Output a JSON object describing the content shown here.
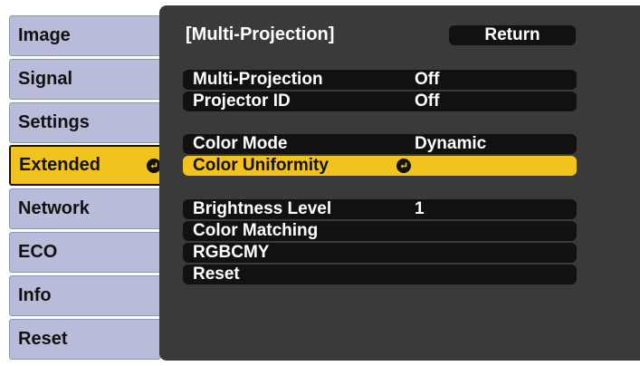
{
  "tabs": [
    {
      "label": "Image",
      "active": false
    },
    {
      "label": "Signal",
      "active": false
    },
    {
      "label": "Settings",
      "active": false
    },
    {
      "label": "Extended",
      "active": true
    },
    {
      "label": "Network",
      "active": false
    },
    {
      "label": "ECO",
      "active": false
    },
    {
      "label": "Info",
      "active": false
    },
    {
      "label": "Reset",
      "active": false
    }
  ],
  "header": {
    "title": "[Multi-Projection]",
    "return_label": "Return"
  },
  "groups": [
    [
      {
        "label": "Multi-Projection",
        "value": "Off"
      },
      {
        "label": "Projector ID",
        "value": "Off"
      }
    ],
    [
      {
        "label": "Color Mode",
        "value": "Dynamic"
      },
      {
        "label": "Color Uniformity",
        "value": "",
        "selected": true,
        "enter_icon": true
      }
    ],
    [
      {
        "label": "Brightness Level",
        "value": "1"
      },
      {
        "label": "Color Matching",
        "value": ""
      },
      {
        "label": "RGBCMY",
        "value": ""
      },
      {
        "label": "Reset",
        "value": ""
      }
    ]
  ],
  "colors": {
    "tab_bg": "#b9bcd9",
    "highlight": "#f2c21f",
    "panel_bg": "#3a3a3a",
    "row_bg": "#111111"
  },
  "icons": {
    "enter": "enter-icon"
  }
}
